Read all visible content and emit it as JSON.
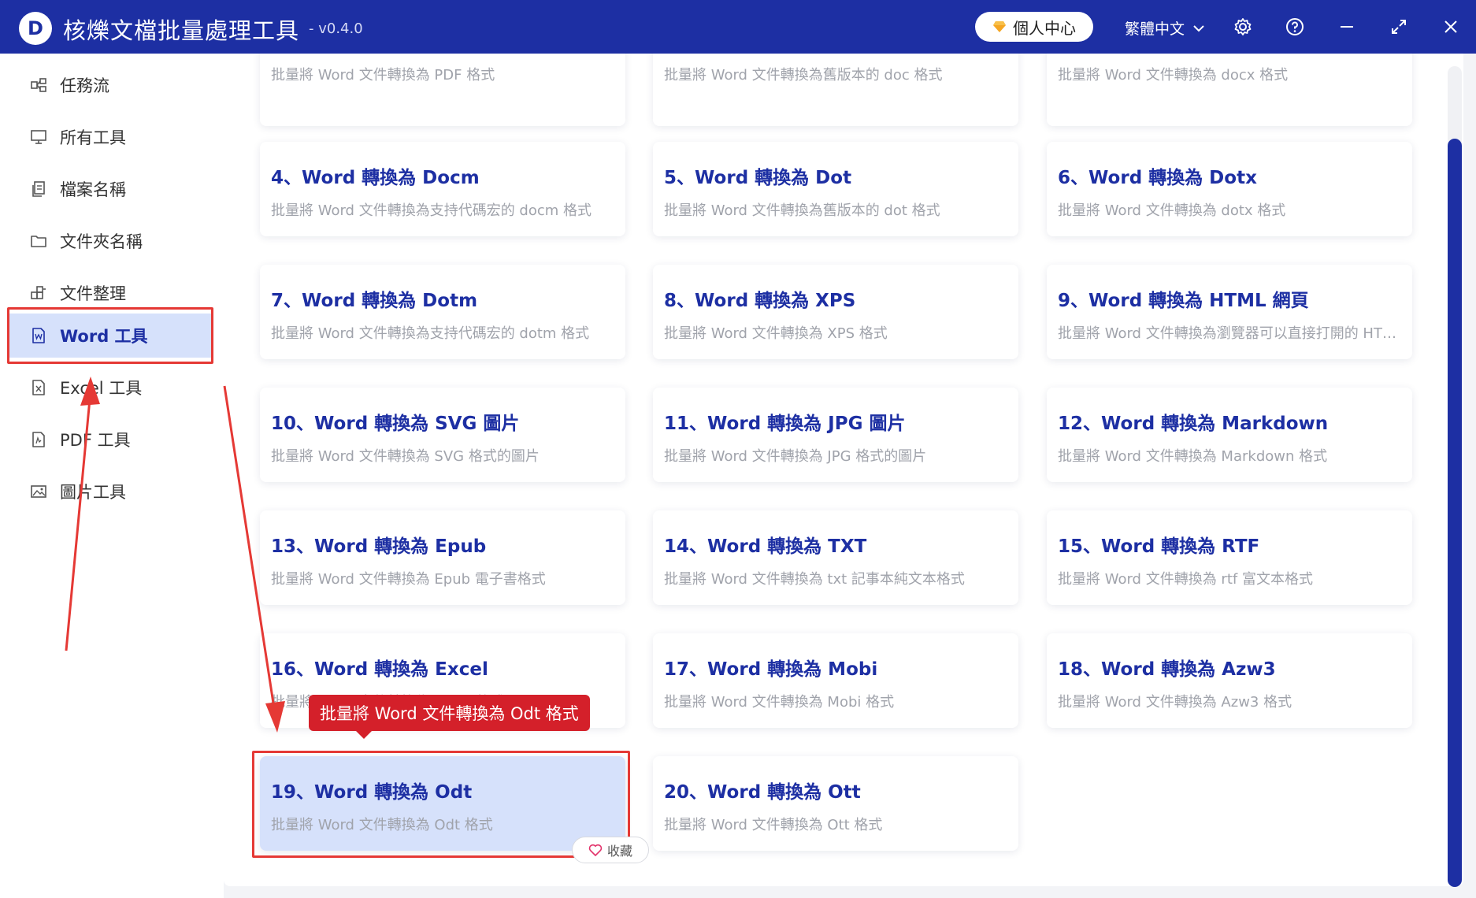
{
  "app": {
    "logo_letter": "D",
    "title": "核爍文檔批量處理工具",
    "version": "- v0.4.0",
    "user_center": "個人中心",
    "language": "繁體中文"
  },
  "sidebar": {
    "items": [
      {
        "label": "任務流",
        "icon": "workflow-icon"
      },
      {
        "label": "所有工具",
        "icon": "monitor-icon"
      },
      {
        "label": "檔案名稱",
        "icon": "file-copy-icon"
      },
      {
        "label": "文件夾名稱",
        "icon": "folder-icon"
      },
      {
        "label": "文件整理",
        "icon": "organize-icon"
      },
      {
        "label": "Word 工具",
        "icon": "word-file-icon",
        "active": true
      },
      {
        "label": "Excel 工具",
        "icon": "excel-file-icon"
      },
      {
        "label": "PDF 工具",
        "icon": "pdf-file-icon"
      },
      {
        "label": "圖片工具",
        "icon": "image-icon"
      }
    ]
  },
  "cards": [
    {
      "title": "",
      "desc": "批量將 Word 文件轉換為 PDF 格式"
    },
    {
      "title": "",
      "desc": "批量將 Word 文件轉換為舊版本的 doc 格式"
    },
    {
      "title": "",
      "desc": "批量將 Word 文件轉換為 docx 格式"
    },
    {
      "title": "4、Word 轉換為 Docm",
      "desc": "批量將 Word 文件轉換為支持代碼宏的 docm 格式"
    },
    {
      "title": "5、Word 轉換為 Dot",
      "desc": "批量將 Word 文件轉換為舊版本的 dot 格式"
    },
    {
      "title": "6、Word 轉換為 Dotx",
      "desc": "批量將 Word 文件轉換為 dotx 格式"
    },
    {
      "title": "7、Word 轉換為 Dotm",
      "desc": "批量將 Word 文件轉換為支持代碼宏的 dotm 格式"
    },
    {
      "title": "8、Word 轉換為 XPS",
      "desc": "批量將 Word 文件轉換為 XPS 格式"
    },
    {
      "title": "9、Word 轉換為 HTML 網頁",
      "desc": "批量將 Word 文件轉換為瀏覽器可以直接打開的 HTM..."
    },
    {
      "title": "10、Word 轉換為 SVG 圖片",
      "desc": "批量將 Word 文件轉換為 SVG 格式的圖片"
    },
    {
      "title": "11、Word 轉換為 JPG 圖片",
      "desc": "批量將 Word 文件轉換為 JPG 格式的圖片"
    },
    {
      "title": "12、Word 轉換為 Markdown",
      "desc": "批量將 Word 文件轉換為 Markdown 格式"
    },
    {
      "title": "13、Word 轉換為 Epub",
      "desc": "批量將 Word 文件轉換為 Epub 電子書格式"
    },
    {
      "title": "14、Word 轉換為 TXT",
      "desc": "批量將 Word 文件轉換為 txt 記事本純文本格式"
    },
    {
      "title": "15、Word 轉換為 RTF",
      "desc": "批量將 Word 文件轉換為 rtf 富文本格式"
    },
    {
      "title": "16、Word 轉換為 Excel",
      "desc": "批量將 Word 文件轉換為 Excel 格式"
    },
    {
      "title": "17、Word 轉換為 Mobi",
      "desc": "批量將 Word 文件轉換為 Mobi 格式"
    },
    {
      "title": "18、Word 轉換為 Azw3",
      "desc": "批量將 Word 文件轉換為 Azw3 格式"
    },
    {
      "title": "19、Word 轉換為 Odt",
      "desc": "批量將 Word 文件轉換為 Odt 格式",
      "active": true
    },
    {
      "title": "20、Word 轉換為 Ott",
      "desc": "批量將 Word 文件轉換為 Ott 格式"
    }
  ],
  "tooltip": "批量將 Word 文件轉換為 Odt 格式",
  "favorite_label": "收藏",
  "colors": {
    "primary": "#1d2fa3",
    "active_bg": "#d6e1fb",
    "annotation": "#e53935",
    "tooltip_bg": "#d4202a"
  }
}
